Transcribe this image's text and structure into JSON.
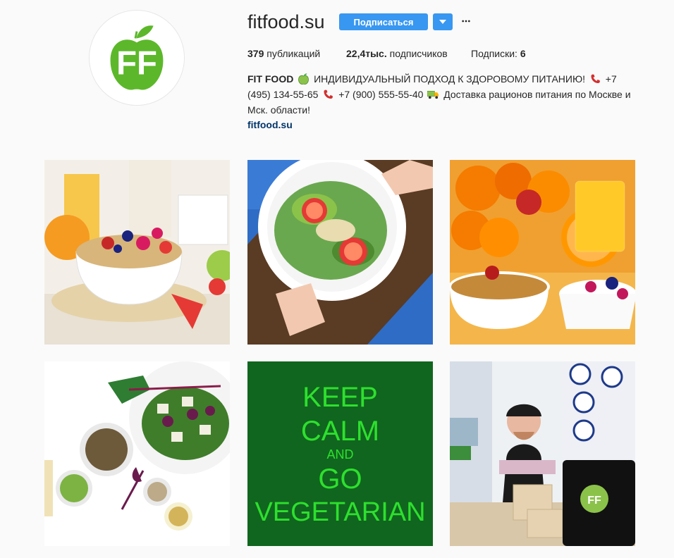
{
  "profile": {
    "username": "fitfood.su",
    "follow_label": "Подписаться",
    "dropdown_icon": "chevron-down-icon",
    "more_icon": "more-options-icon",
    "avatar_icon": "fitfood-apple-logo",
    "colors": {
      "accent": "#3897f0",
      "logo_green": "#5cb82a",
      "link": "#003569"
    }
  },
  "stats": {
    "posts_count": "379",
    "posts_label": "публикаций",
    "followers_count": "22,4тыс.",
    "followers_label": "подписчиков",
    "following_label": "Подписки:",
    "following_count": "6"
  },
  "bio": {
    "name": "FIT FOOD",
    "part1": "ИНДИВИДУАЛЬНЫЙ ПОДХОД К ЗДОРОВОМУ ПИТАНИЮ!",
    "part2": "+7 (495) 134-55-65",
    "part3": "+7 (900) 555-55-40",
    "part4": "Доставка рационов питания по Москве и Мск. области!",
    "emoji1": "green-apple-emoji",
    "emoji2": "telephone-emoji",
    "emoji3": "telephone-emoji",
    "emoji4": "delivery-truck-emoji",
    "link": "fitfood.su"
  },
  "posts": [
    {
      "name": "post-breakfast-muesli"
    },
    {
      "name": "post-salad-plate"
    },
    {
      "name": "post-fruits-muesli-juice"
    },
    {
      "name": "post-beet-salad-lentils"
    },
    {
      "name": "post-keep-calm-vegetarian",
      "text": {
        "line1": "KEEP",
        "line2": "CALM",
        "line3": "AND",
        "line4": "GO",
        "line5": "VEGETARIAN"
      }
    },
    {
      "name": "post-radio-studio-fitfood"
    }
  ]
}
